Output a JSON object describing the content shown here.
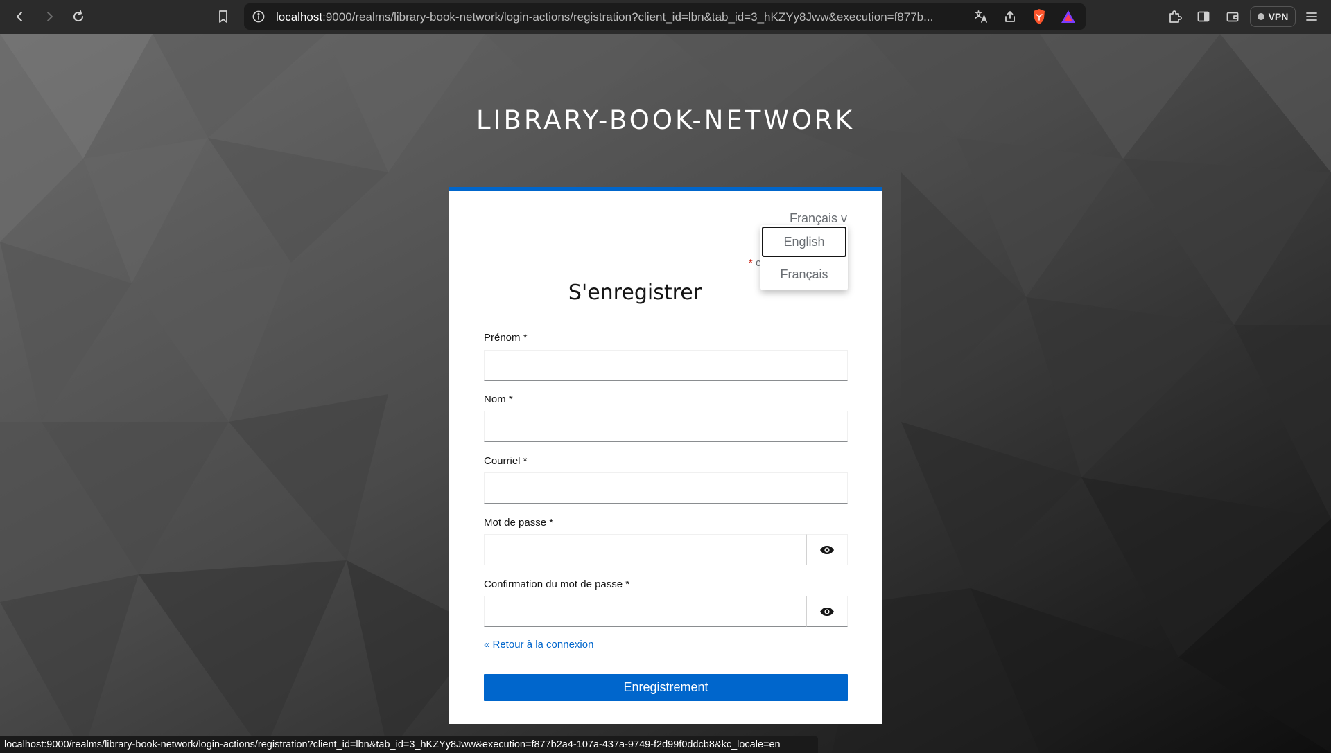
{
  "browser": {
    "url_host": "localhost",
    "url_rest": ":9000/realms/library-book-network/login-actions/registration?client_id=lbn&tab_id=3_hKZYy8Jww&execution=f877b...",
    "vpn_label": "VPN"
  },
  "page": {
    "realm_title": "LIBRARY-BOOK-NETWORK"
  },
  "locale": {
    "current": "Français",
    "caret": "v",
    "options": [
      "English",
      "Français"
    ]
  },
  "form": {
    "required_star": "*",
    "required_note": "c",
    "title": "S'enregistrer",
    "first_name_label": "Prénom *",
    "last_name_label": "Nom *",
    "email_label": "Courriel *",
    "password_label": "Mot de passe *",
    "password_confirm_label": "Confirmation du mot de passe *",
    "back_link": "« Retour à la connexion",
    "submit_label": "Enregistrement",
    "first_name_value": "",
    "last_name_value": "",
    "email_value": "",
    "password_value": "",
    "password_confirm_value": ""
  },
  "status_bar": {
    "text": "localhost:9000/realms/library-book-network/login-actions/registration?client_id=lbn&tab_id=3_hKZYy8Jww&execution=f877b2a4-107a-437a-9749-f2d99f0ddcb8&kc_locale=en"
  },
  "icons": [
    "back-icon",
    "forward-icon",
    "reload-icon",
    "bookmark-icon",
    "site-info-icon",
    "translate-icon",
    "share-icon",
    "brave-shield-icon",
    "brave-rewards-icon",
    "extensions-icon",
    "sidebar-icon",
    "wallet-icon",
    "menu-icon",
    "eye-icon"
  ]
}
